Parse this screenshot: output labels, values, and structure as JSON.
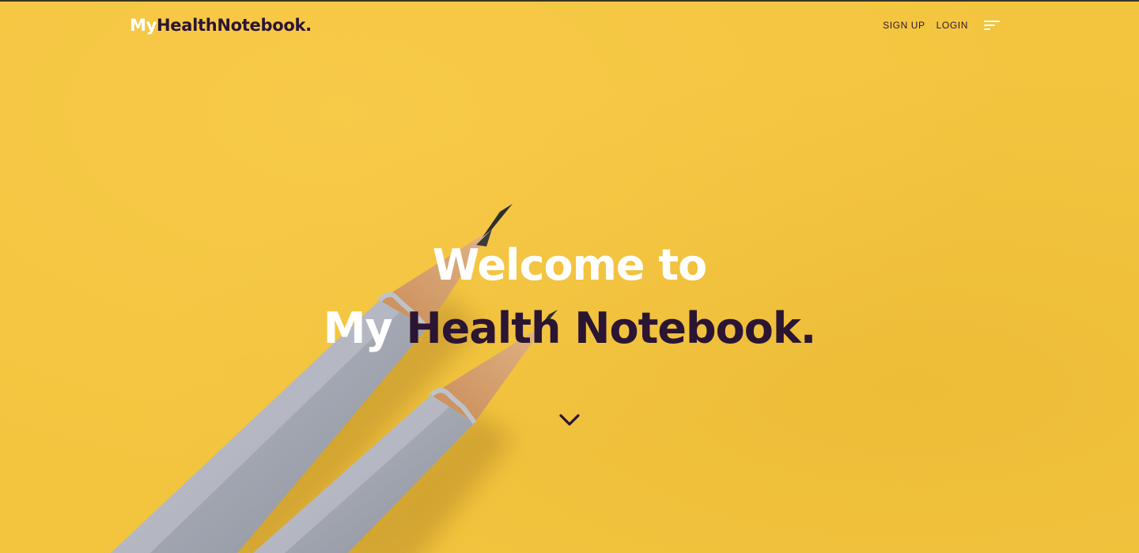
{
  "brand": {
    "logo_part1": "My",
    "logo_part2": "HealthNotebook."
  },
  "nav": {
    "signup_label": "SIGN UP",
    "login_label": "LOGIN",
    "menu_icon": "hamburger-menu-icon"
  },
  "hero": {
    "line1": "Welcome to",
    "line2_part1": "My ",
    "line2_part2": "Health Notebook.",
    "scroll_icon": "chevron-down-icon",
    "background_image": "two grey pencils on yellow paper"
  },
  "colors": {
    "background": "#f3c53f",
    "white_text": "#ffffff",
    "dark_accent": "#2b1533",
    "pencil_body": "#a6a9b4",
    "pencil_wood": "#d6a06a",
    "pencil_lead": "#2e2e2e"
  }
}
